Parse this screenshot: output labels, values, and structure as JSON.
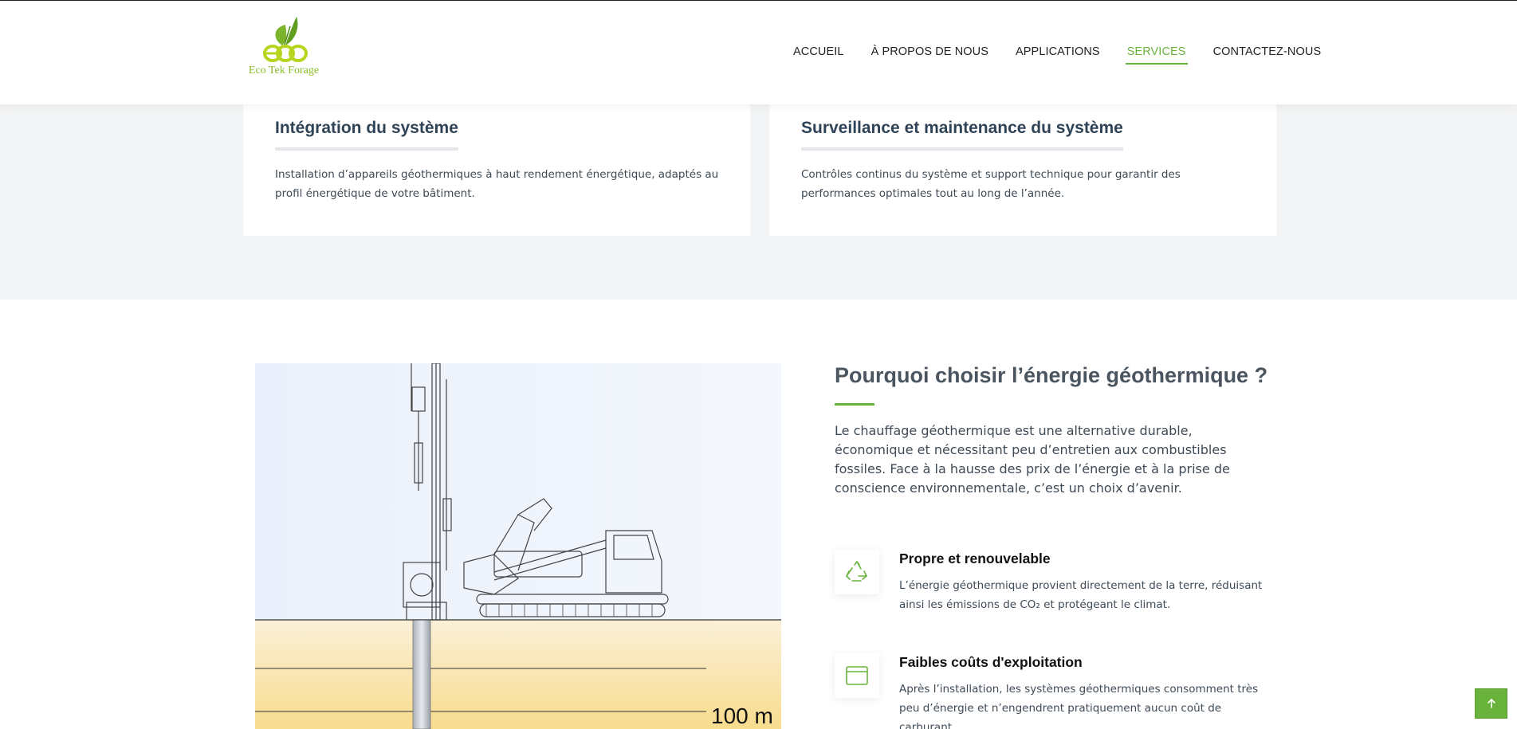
{
  "header": {
    "logo_text": "Eco Tek Forage",
    "logo_mark": "eco",
    "nav": [
      {
        "label": "ACCUEIL"
      },
      {
        "label": "À PROPOS DE NOUS"
      },
      {
        "label": "APPLICATIONS"
      },
      {
        "label": "SERVICES"
      },
      {
        "label": "CONTACTEZ-NOUS"
      }
    ],
    "active_nav": "SERVICES",
    "accent_color": "#69b33c"
  },
  "service_cards": [
    {
      "title": "Intégration du système",
      "text": "Installation d’appareils géothermiques à haut rendement énergétique, adaptés au profil énergétique de votre bâtiment."
    },
    {
      "title": "Surveillance et maintenance du système",
      "text": "Contrôles continus du système et support technique pour garantir des performances optimales tout au long de l’année."
    }
  ],
  "illustration": {
    "depth_label": "100 m"
  },
  "why": {
    "title": "Pourquoi choisir l’énergie géothermique ?",
    "text": "Le chauffage géothermique est une alternative durable, économique et nécessitant peu d’entretien aux combustibles fossiles. Face à la hausse des prix de l’énergie et à la prise de conscience environnementale, c’est un choix d’avenir.",
    "features": [
      {
        "icon": "recycle-icon",
        "title": "Propre et renouvelable",
        "text": "L’énergie géothermique provient directement de la terre, réduisant ainsi les émissions de CO₂ et protégeant le climat."
      },
      {
        "icon": "wallet-icon",
        "title": "Faibles coûts d'exploitation",
        "text": "Après l’installation, les systèmes géothermiques consomment très peu d’énergie et n’engendrent pratiquement aucun coût de carburant."
      }
    ]
  },
  "scroll_top": {
    "icon": "arrow-up-icon"
  }
}
